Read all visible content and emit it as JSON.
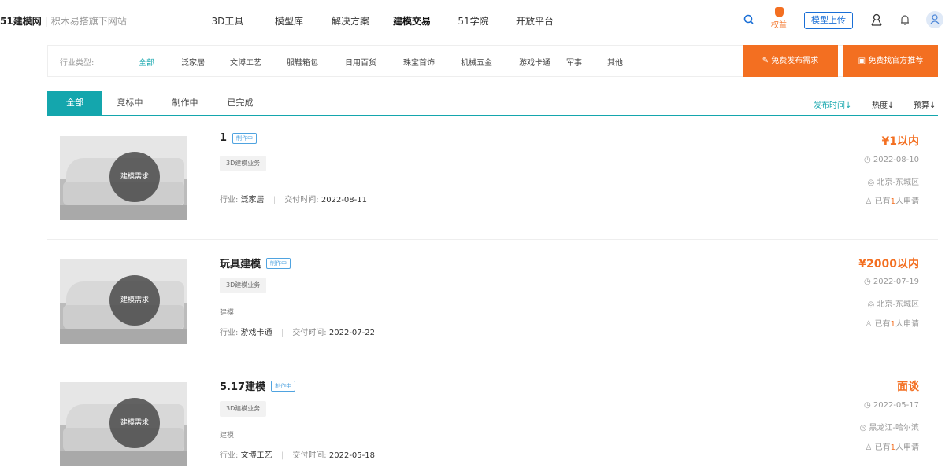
{
  "nav": {
    "brand": "51建模网",
    "sub_brand": "积木易搭旗下网站",
    "items": [
      "3D工具",
      "模型库",
      "解决方案",
      "建模交易",
      "51学院",
      "开放平台"
    ],
    "active_index": 3,
    "quanyi_label": "权益",
    "upload_label": "模型上传"
  },
  "filter": {
    "label": "行业类型:",
    "items": [
      "全部",
      "泛家居",
      "文博工艺",
      "服鞋箱包",
      "日用百货",
      "珠宝首饰",
      "机械五金",
      "游戏卡通",
      "军事",
      "其他"
    ],
    "active_index": 0,
    "publish_button": "免费发布需求",
    "recommend_button": "免费找官方推荐"
  },
  "tabs": {
    "items": [
      "全部",
      "竞标中",
      "制作中",
      "已完成"
    ],
    "active_index": 0,
    "sorts": [
      "发布时间↓",
      "热度↓",
      "预算↓"
    ],
    "active_sort": 0
  },
  "cards": [
    {
      "title": "1",
      "status": "制作中",
      "tag": "3D建模业务",
      "desc": "",
      "industry_label": "行业:",
      "industry": "泛家居",
      "delivery_label": "交付时间:",
      "delivery": "2022-08-11",
      "price": "¥1以内",
      "date": "2022-08-10",
      "location": "北京-东城区",
      "applied_prefix": "已有",
      "applied_count": "1",
      "applied_suffix": "人申请",
      "thumb_label": "建模需求"
    },
    {
      "title": "玩具建模",
      "status": "制作中",
      "tag": "3D建模业务",
      "desc": "建模",
      "industry_label": "行业:",
      "industry": "游戏卡通",
      "delivery_label": "交付时间:",
      "delivery": "2022-07-22",
      "price": "¥2000以内",
      "date": "2022-07-19",
      "location": "北京-东城区",
      "applied_prefix": "已有",
      "applied_count": "1",
      "applied_suffix": "人申请",
      "thumb_label": "建模需求"
    },
    {
      "title": "5.17建模",
      "status": "制作中",
      "tag": "3D建模业务",
      "desc": "建模",
      "industry_label": "行业:",
      "industry": "文博工艺",
      "delivery_label": "交付时间:",
      "delivery": "2022-05-18",
      "price": "面谈",
      "date": "2022-05-17",
      "location": "黑龙江-哈尔滨",
      "applied_prefix": "已有",
      "applied_count": "1",
      "applied_suffix": "人申请",
      "thumb_label": "建模需求"
    }
  ]
}
